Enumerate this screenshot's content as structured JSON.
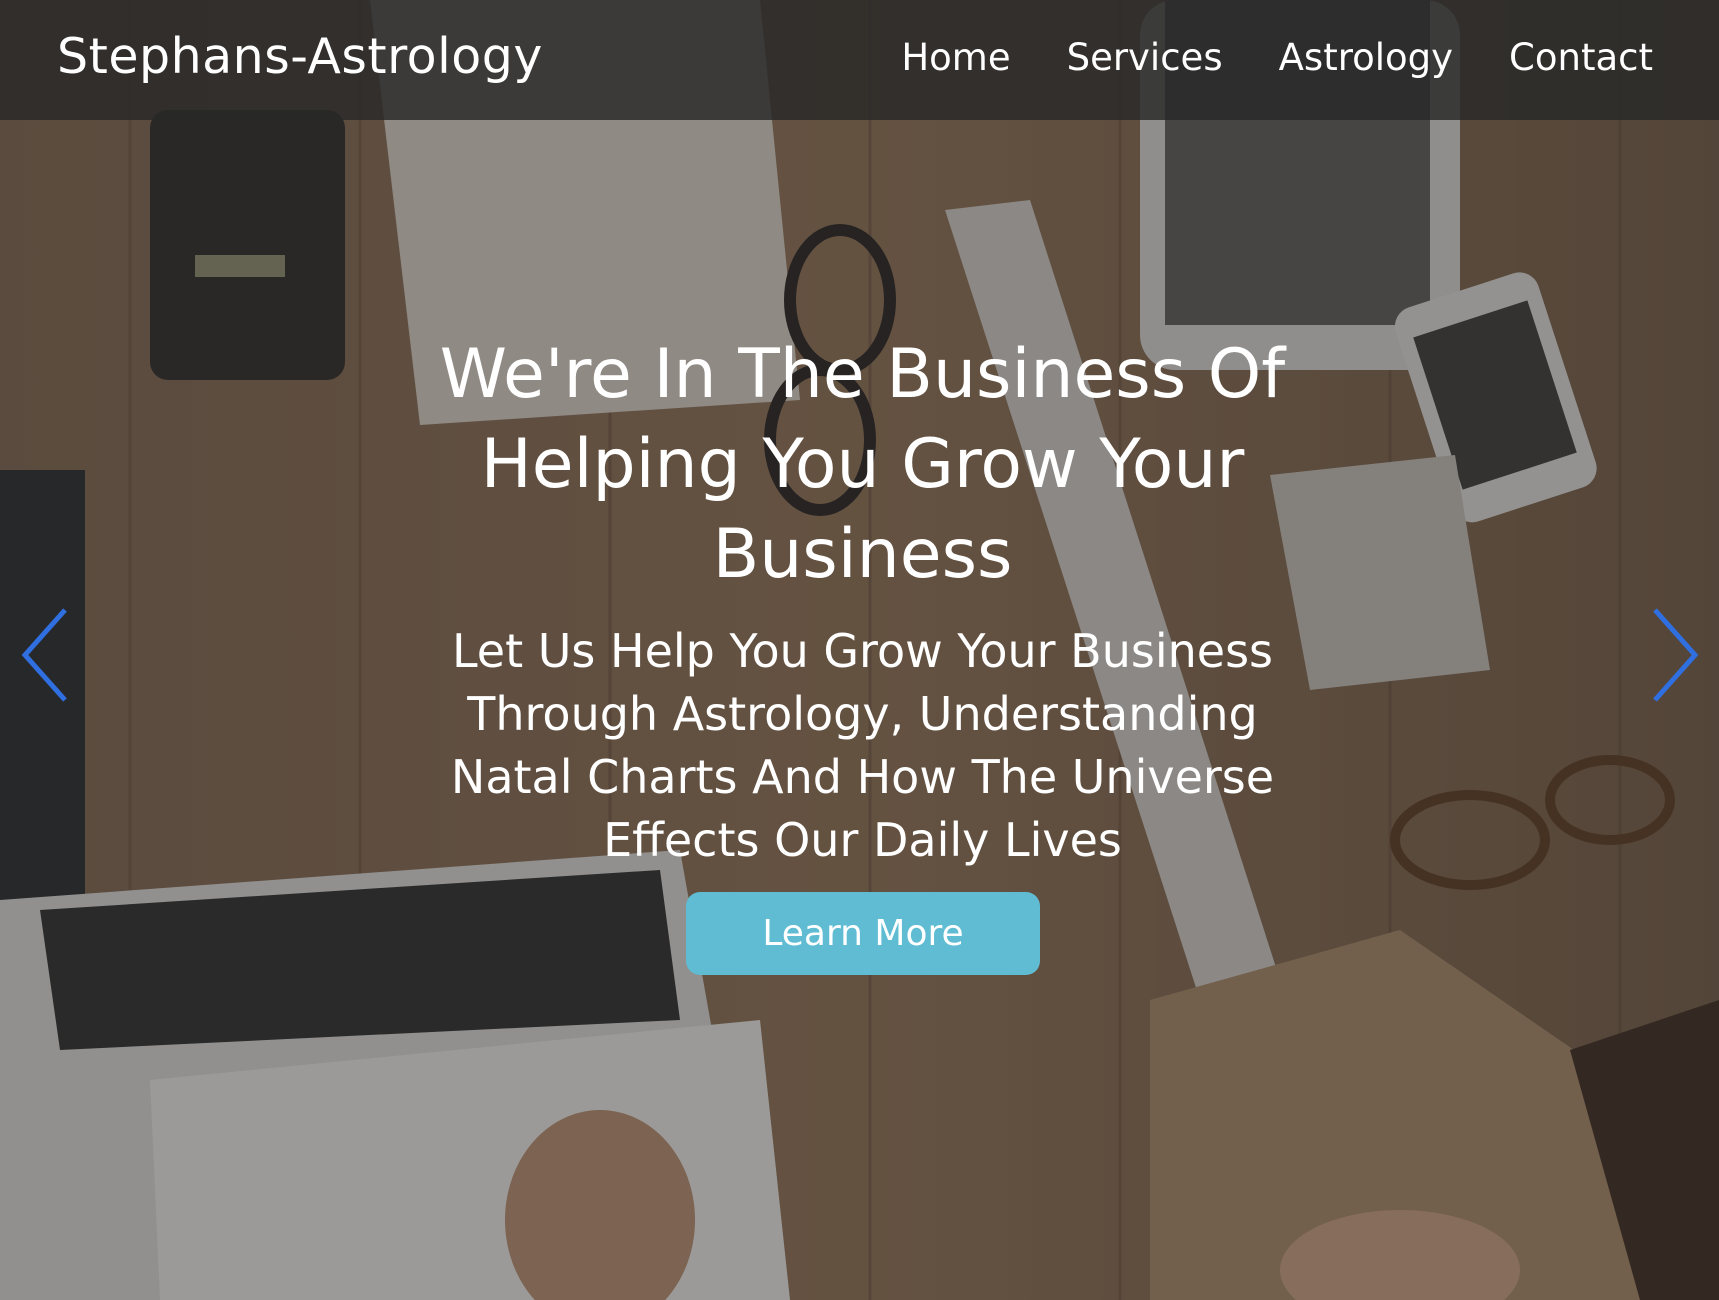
{
  "navbar": {
    "brand": "Stephans-Astrology",
    "links": [
      "Home",
      "Services",
      "Astrology",
      "Contact"
    ]
  },
  "hero": {
    "headline": "We're In The Business Of Helping You Grow Your Business",
    "subheadline": "Let Us Help You Grow Your Business Through Astrology, Understanding Natal Charts And How The Universe Effects Our Daily Lives",
    "cta_label": "Learn More"
  },
  "carousel": {
    "prev_icon": "chevron-left-icon",
    "next_icon": "chevron-right-icon",
    "arrow_color": "#2f6fe0"
  },
  "colors": {
    "navbar_bg": "#282828",
    "cta_bg": "#5fbcd3",
    "text": "#ffffff"
  }
}
